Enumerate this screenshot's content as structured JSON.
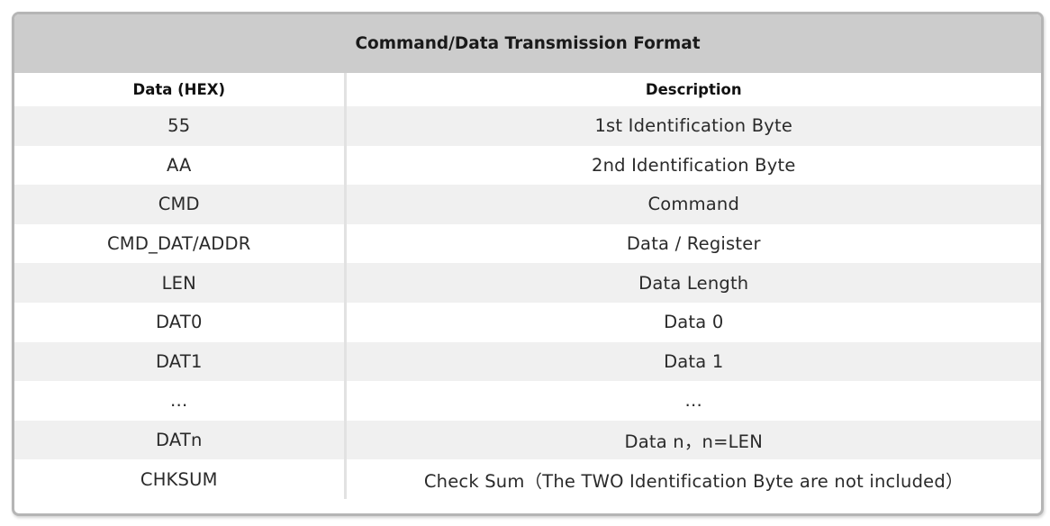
{
  "title": "Command/Data Transmission Format",
  "headers": {
    "col1": "Data (HEX)",
    "col2": "Description"
  },
  "rows": [
    {
      "data": "55",
      "description": "1st Identification Byte"
    },
    {
      "data": "AA",
      "description": "2nd Identification Byte"
    },
    {
      "data": "CMD",
      "description": "Command"
    },
    {
      "data": "CMD_DAT/ADDR",
      "description": "Data / Register"
    },
    {
      "data": "LEN",
      "description": "Data Length"
    },
    {
      "data": "DAT0",
      "description": "Data 0"
    },
    {
      "data": "DAT1",
      "description": "Data 1"
    },
    {
      "data": "…",
      "description": "…"
    },
    {
      "data": "DATn",
      "description": "Data n，n=LEN"
    },
    {
      "data": "CHKSUM",
      "description": "Check Sum（The TWO Identification Byte are not included）"
    }
  ],
  "colors": {
    "title_bg": "#cccccc",
    "stripe_bg": "#f0f0f0",
    "border": "#b5b5b5"
  }
}
